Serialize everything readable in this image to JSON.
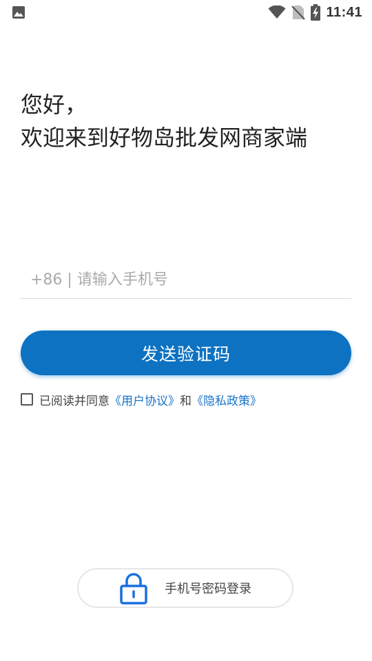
{
  "status_bar": {
    "time": "11:41",
    "left_icon": "image-icon",
    "icons": [
      "wifi-icon",
      "no-sim-icon",
      "battery-charging-icon"
    ]
  },
  "greeting": {
    "line1": "您好，",
    "line2": "欢迎来到好物岛批发网商家端"
  },
  "phone_input": {
    "value": "",
    "placeholder": "+86 | 请输入手机号"
  },
  "send_button": {
    "label": "发送验证码",
    "color": "#0d72c2"
  },
  "agreement": {
    "checked": false,
    "prefix": "已阅读并同意",
    "user_agreement": "《用户协议》",
    "conjunction": "和",
    "privacy_policy": "《隐私政策》",
    "link_color": "#1a73c8"
  },
  "alt_login": {
    "icon": "lock-icon",
    "label": "手机号密码登录",
    "icon_color": "#1a6fe0"
  }
}
